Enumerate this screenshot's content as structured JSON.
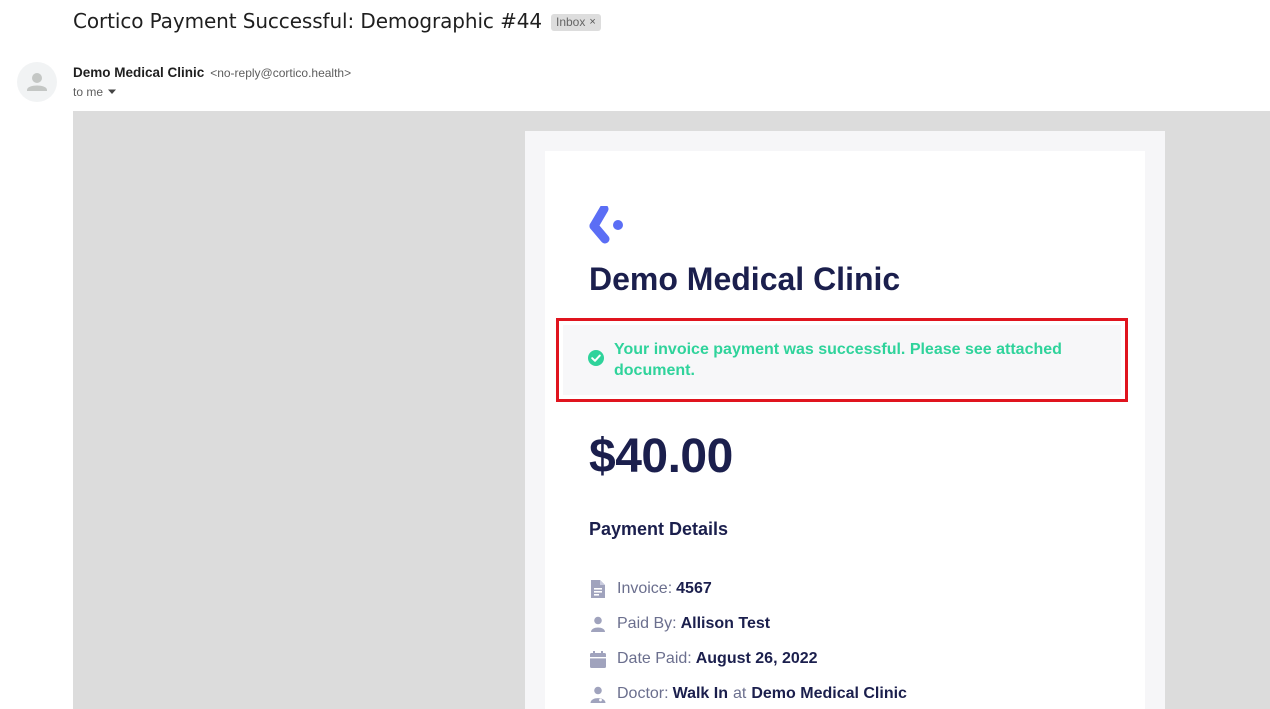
{
  "email": {
    "subject": "Cortico Payment Successful: Demographic #44",
    "label_chip": "Inbox",
    "label_remove": "×",
    "sender_name": "Demo Medical Clinic",
    "sender_email": "<no-reply@cortico.health>",
    "recipient": "to me"
  },
  "message": {
    "clinic_name": "Demo Medical Clinic",
    "success_text": "Your invoice payment was successful. Please see attached document.",
    "amount": "$40.00",
    "details_title": "Payment Details",
    "invoice": {
      "label": "Invoice:",
      "value": "4567"
    },
    "paid_by": {
      "label": "Paid By:",
      "value": "Allison Test"
    },
    "date_paid": {
      "label": "Date Paid:",
      "value": "August 26, 2022"
    },
    "doctor": {
      "label": "Doctor:",
      "value": "Walk In",
      "at": "at",
      "clinic": "Demo Medical Clinic"
    }
  },
  "icons": {
    "logo": "cortico-logo",
    "success": "check-circle-icon",
    "invoice": "document-icon",
    "paid_by": "person-icon",
    "date_paid": "calendar-icon",
    "doctor": "doctor-icon"
  },
  "colors": {
    "brand_blue": "#5b6ef5",
    "navy_text": "#1b1f4d",
    "success_green": "#2fd39b",
    "highlight_red": "#e0141e",
    "email_background": "#dcdcdc"
  }
}
